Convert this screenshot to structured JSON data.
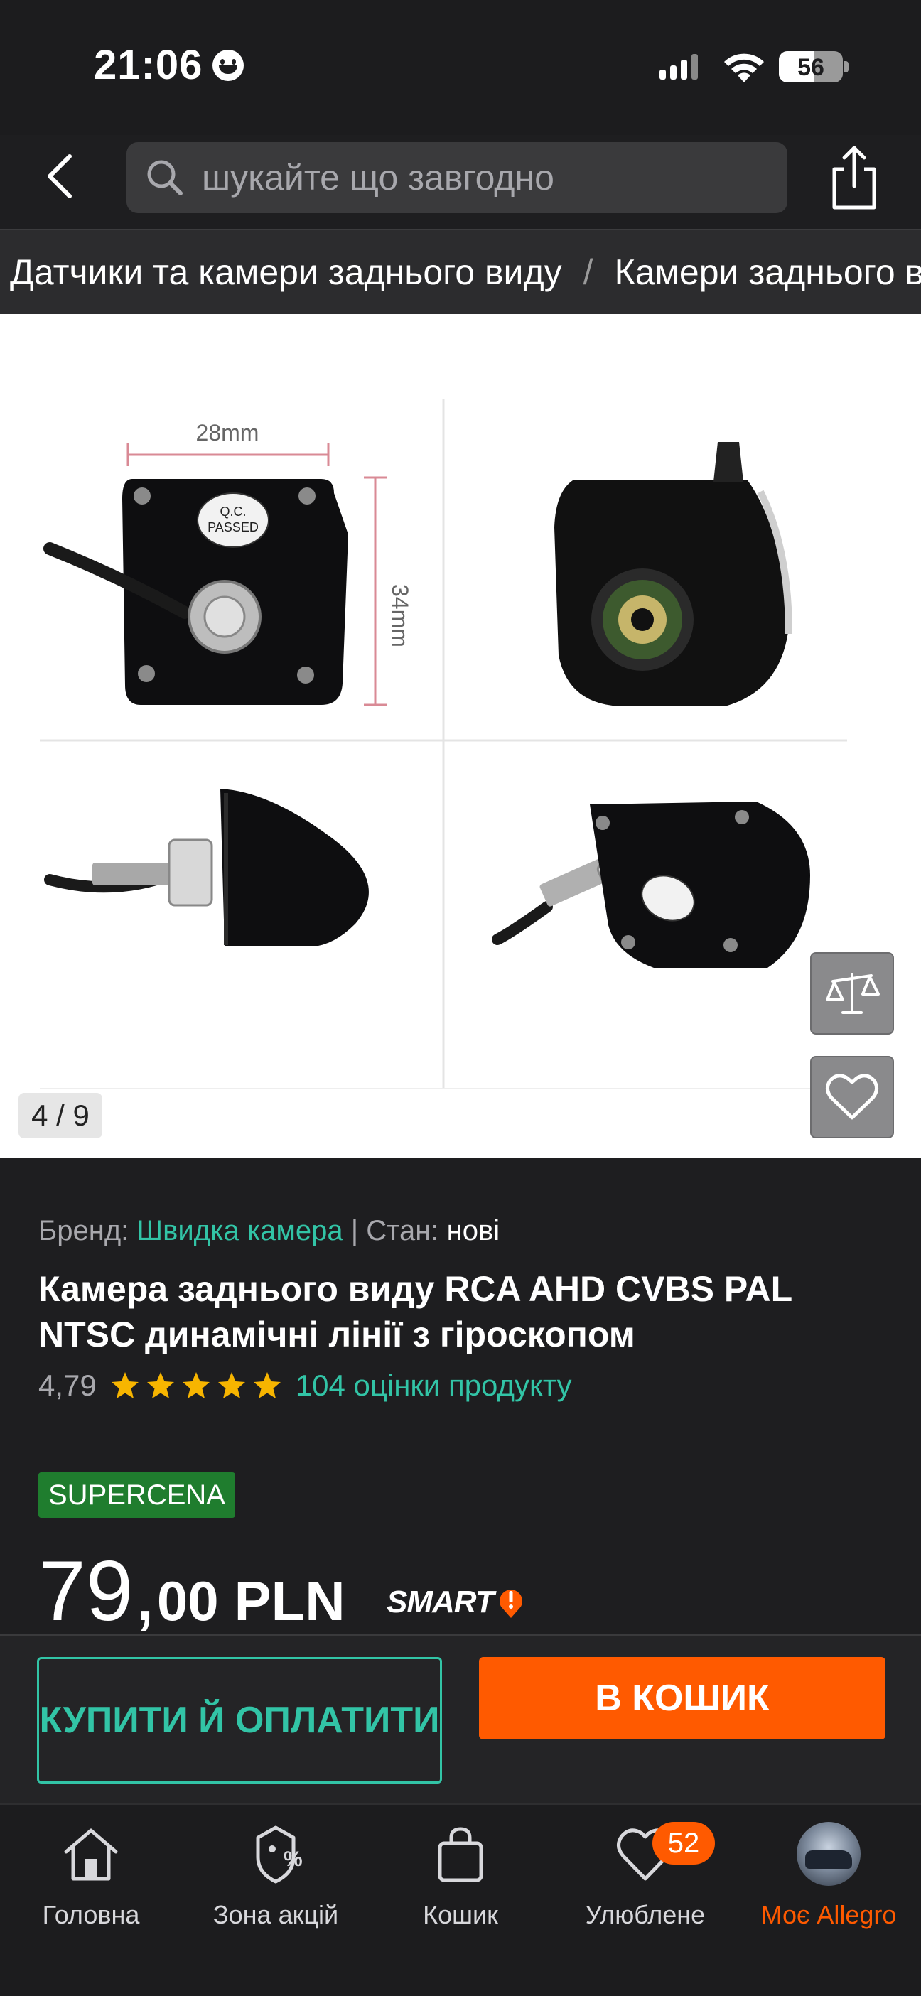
{
  "status_bar": {
    "time": "21:06",
    "battery": "56"
  },
  "header": {
    "search_placeholder": "шукайте що завгодно"
  },
  "breadcrumb": {
    "items": [
      "Датчики та камери заднього виду",
      "Камери заднього виду"
    ],
    "separator": "/"
  },
  "gallery": {
    "counter": "4 / 9",
    "image_labels": {
      "width_dim": "28mm",
      "height_dim": "34mm",
      "qc_line1": "Q.C.",
      "qc_line2": "PASSED"
    }
  },
  "product": {
    "brand_label": "Бренд:",
    "brand_value": "Швидка камера",
    "divider": "|",
    "condition_label": "Стан:",
    "condition_value": "нові",
    "title": "Камера заднього виду RCA AHD CVBS PAL NTSC динамічні лінії з гіроскопом",
    "rating": "4,79",
    "stars": 5,
    "reviews": "104 оцінки продукту",
    "promo_badge": "SUPERCENA",
    "price_int": "79,",
    "price_dec": "00",
    "currency": "PLN",
    "smart_label": "SMART"
  },
  "actions": {
    "buy_now": "КУПИТИ Й ОПЛАТИТИ",
    "add_to_cart": "В КОШИК"
  },
  "tabs": [
    {
      "label": "Головна",
      "icon": "home-icon"
    },
    {
      "label": "Зона акцій",
      "icon": "promo-tag-icon"
    },
    {
      "label": "Кошик",
      "icon": "bag-icon"
    },
    {
      "label": "Улюблене",
      "icon": "heart-icon",
      "badge": "52"
    },
    {
      "label": "Моє Allegro",
      "icon": "avatar",
      "active": true
    }
  ],
  "colors": {
    "accent": "#ff5a00",
    "teal": "#32c4a6",
    "supercena": "#1f7d2e",
    "background": "#1e1e20"
  }
}
